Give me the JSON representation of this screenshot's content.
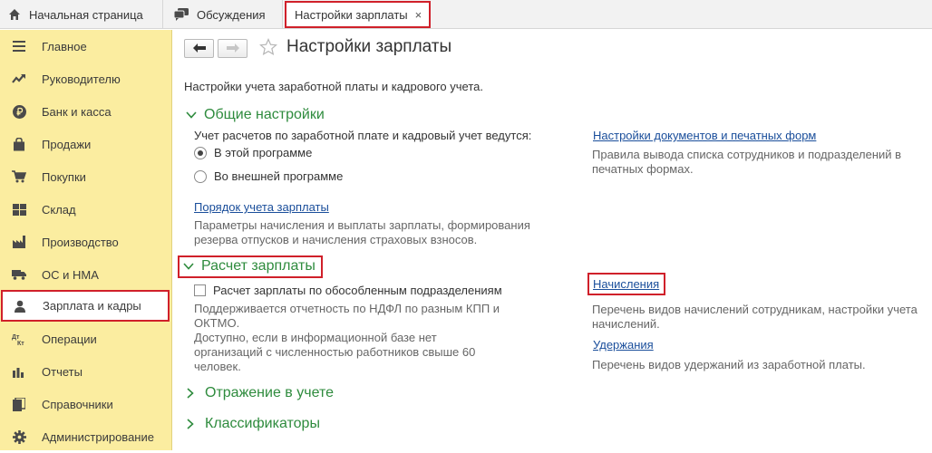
{
  "tabs": {
    "home_label": "Начальная страница",
    "discussions_label": "Обсуждения",
    "active_label": "Настройки зарплаты",
    "close_glyph": "×"
  },
  "sidebar": {
    "items": [
      {
        "label": "Главное",
        "icon": "menu-icon"
      },
      {
        "label": "Руководителю",
        "icon": "trend-icon"
      },
      {
        "label": "Банк и касса",
        "icon": "ruble-coin-icon"
      },
      {
        "label": "Продажи",
        "icon": "shopping-bag-icon"
      },
      {
        "label": "Покупки",
        "icon": "cart-icon"
      },
      {
        "label": "Склад",
        "icon": "warehouse-grid-icon"
      },
      {
        "label": "Производство",
        "icon": "factory-icon"
      },
      {
        "label": "ОС и НМА",
        "icon": "truck-icon"
      },
      {
        "label": "Зарплата и кадры",
        "icon": "person-icon",
        "active": true
      },
      {
        "label": "Операции",
        "icon": "debit-credit-icon"
      },
      {
        "label": "Отчеты",
        "icon": "bar-chart-icon"
      },
      {
        "label": "Справочники",
        "icon": "book-icon"
      },
      {
        "label": "Администрирование",
        "icon": "gear-icon"
      }
    ]
  },
  "page": {
    "title": "Настройки зарплаты",
    "description": "Настройки учета заработной платы и кадрового учета."
  },
  "general": {
    "header": "Общие настройки",
    "question": "Учет расчетов по заработной плате и кадровый учет ведутся:",
    "options": [
      {
        "label": "В этой программе",
        "selected": true
      },
      {
        "label": "Во внешней программе",
        "selected": false
      }
    ],
    "payroll_order_link": "Порядок учета зарплаты",
    "payroll_order_desc_1": "Параметры начисления и выплаты зарплаты, формирования",
    "payroll_order_desc_2": "резерва отпусков и начисления страховых взносов.",
    "docs_link": "Настройки документов и печатных форм",
    "docs_desc_1": "Правила вывода списка сотрудников и подразделений в",
    "docs_desc_2": "печатных формах."
  },
  "payroll": {
    "header": "Расчет зарплаты",
    "checkbox_label": "Расчет зарплаты по обособленным подразделениям",
    "checkbox_checked": false,
    "note_1": "Поддерживается отчетность по НДФЛ по разным КПП и",
    "note_2": "ОКТМО.",
    "note_3": "Доступно, если в информационной базе нет",
    "note_4": "организаций с численностью работников свыше 60",
    "note_5": "человек.",
    "accruals_link": "Начисления",
    "accruals_desc_1": "Перечень видов начислений сотрудникам, настройки учета",
    "accruals_desc_2": "начислений.",
    "deductions_link": "Удержания",
    "deductions_desc": "Перечень видов удержаний из заработной платы."
  },
  "collapsed_groups": {
    "accounting": "Отражение в учете",
    "classifiers": "Классификаторы"
  },
  "colors": {
    "sidebar_bg": "#fbeda0",
    "group_header": "#2e8b3d",
    "link": "#1a4e9b",
    "highlight_frame": "#d0202a"
  }
}
